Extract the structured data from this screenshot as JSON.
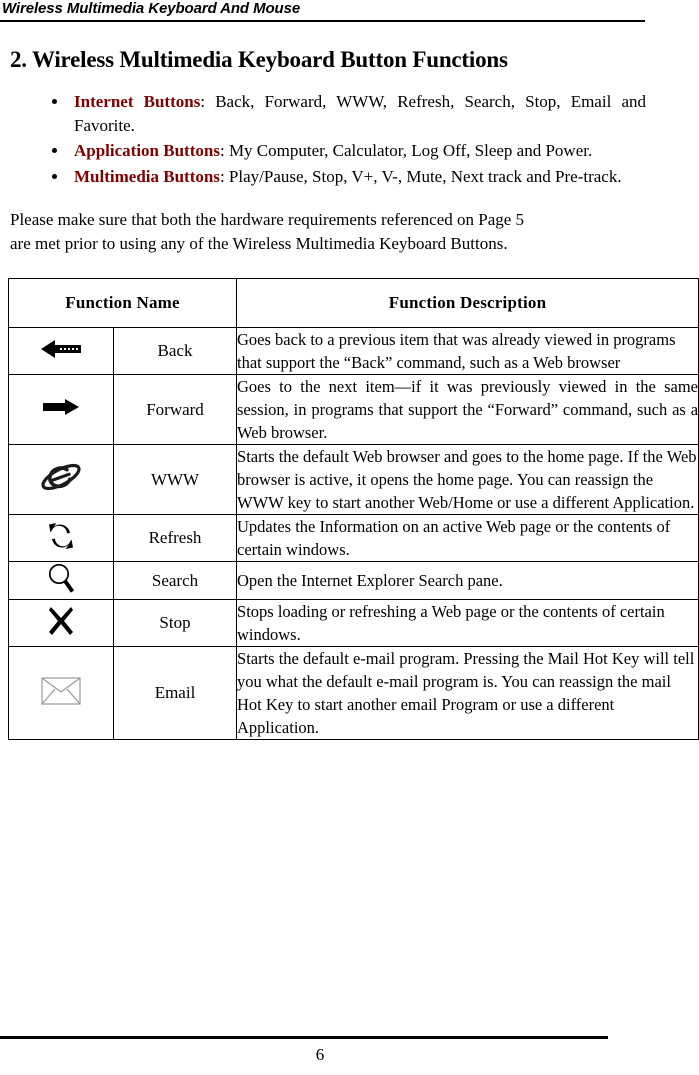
{
  "header": {
    "running_title": "Wireless Multimedia Keyboard And Mouse"
  },
  "section": {
    "title": "2. Wireless Multimedia Keyboard Button Functions"
  },
  "bullets": [
    {
      "term": "Internet Buttons",
      "separator": ": ",
      "text": "Back, Forward, WWW, Refresh, Search, Stop, Email and Favorite."
    },
    {
      "term": "Application Buttons",
      "separator": ": ",
      "text": "My Computer, Calculator, Log Off, Sleep and Power."
    },
    {
      "term": "Multimedia Buttons",
      "separator": ": ",
      "text": "Play/Pause, Stop, V+, V-, Mute, Next track and Pre-track."
    }
  ],
  "notice": {
    "line1": "Please make sure that both the hardware requirements referenced on Page 5",
    "line2": "are met prior to using any of the Wireless Multimedia Keyboard Buttons."
  },
  "table": {
    "headers": {
      "function_name": "Function Name",
      "function_description": "Function Description"
    },
    "rows": [
      {
        "icon": "arrow-left-icon",
        "name": "Back",
        "description": "Goes back to a previous item that was already viewed in programs that support the “Back” command, such as a Web browser",
        "justified": false
      },
      {
        "icon": "arrow-right-icon",
        "name": "Forward",
        "description": "Goes to the next item—if it was previously viewed in the same session, in programs that support the “Forward” command, such as a Web browser.",
        "justified": true
      },
      {
        "icon": "internet-explorer-icon",
        "name": "WWW",
        "description": "Starts the default Web browser and goes to the home page. If the Web browser is active, it opens the home page. You can reassign the WWW key to start another Web/Home or use a different Application.",
        "justified": false
      },
      {
        "icon": "refresh-icon",
        "name": "Refresh",
        "description": "Updates the Information on an active Web page or the contents of certain windows.",
        "justified": false
      },
      {
        "icon": "search-icon",
        "name": "Search",
        "description": "Open the Internet Explorer Search pane.",
        "justified": false
      },
      {
        "icon": "close-x-icon",
        "name": "Stop",
        "description": "Stops loading or refreshing a Web page or the contents of certain windows.",
        "justified": false
      },
      {
        "icon": "envelope-icon",
        "name": "Email",
        "description": "Starts the default e-mail program. Pressing the Mail Hot Key will tell you what the default e-mail program is. You can reassign the mail Hot Key to start another email Program or use a different Application.",
        "justified": false
      }
    ]
  },
  "footer": {
    "page_number": "6"
  },
  "colors": {
    "term_accent": "#800000",
    "text": "#000000",
    "rule": "#000000",
    "envelope_outline": "#9a9a9a"
  }
}
